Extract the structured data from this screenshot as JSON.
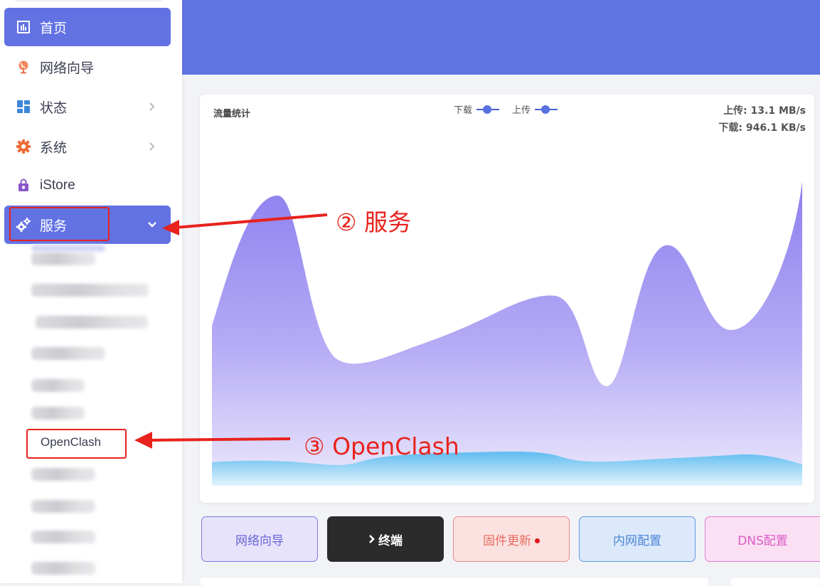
{
  "sidebar": {
    "items": [
      {
        "label": "首页",
        "icon": "dashboard-icon"
      },
      {
        "label": "网络向导",
        "icon": "globe-icon"
      },
      {
        "label": "状态",
        "icon": "grid-icon"
      },
      {
        "label": "系统",
        "icon": "gear-icon"
      },
      {
        "label": "iStore",
        "icon": "shopping-bag-icon"
      },
      {
        "label": "服务",
        "icon": "services-gears-icon"
      }
    ],
    "submenu": {
      "visible_item": "OpenClash"
    }
  },
  "traffic": {
    "title": "流量统计",
    "legend_download": "下载",
    "legend_upload": "上传",
    "upload_rate": "上传: 13.1 MB/s",
    "download_rate": "下载: 946.1 KB/s"
  },
  "chart_data": {
    "type": "area",
    "title": "流量统计",
    "grid": false,
    "legend": "top-center",
    "series": [
      {
        "name": "下载",
        "color": "#8f86f0"
      },
      {
        "name": "上传",
        "color": "#6cc3f2"
      }
    ]
  },
  "quick_actions": [
    {
      "label": "网络向导"
    },
    {
      "label": "终端"
    },
    {
      "label": "固件更新"
    },
    {
      "label": "内网配置"
    },
    {
      "label": "DNS配置"
    }
  ],
  "annotations": {
    "step2": "② 服务",
    "step3": "③ OpenClash"
  },
  "colors": {
    "accent": "#6272e3",
    "header": "#6073e3",
    "annotation_red": "#e8221c"
  }
}
